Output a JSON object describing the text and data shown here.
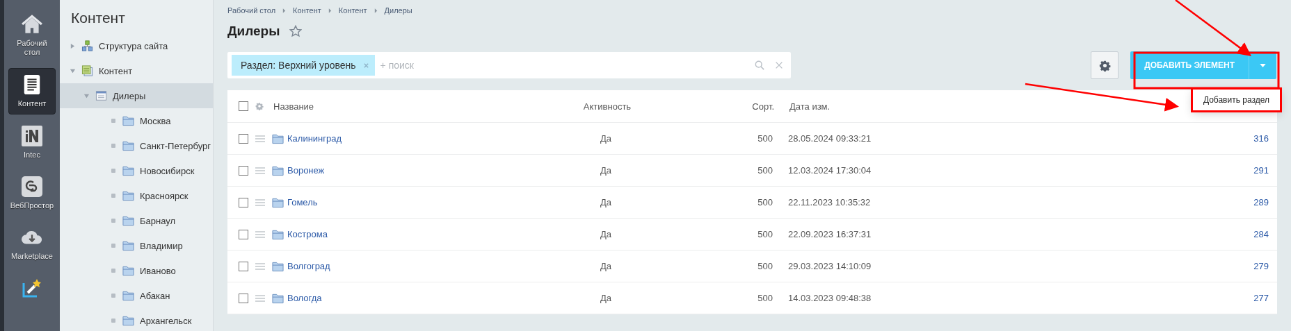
{
  "left_menu": [
    {
      "label": "Рабочий стол",
      "selected": false
    },
    {
      "label": "Контент",
      "selected": true
    },
    {
      "label": "Intec",
      "selected": false
    },
    {
      "label": "ВебПростор",
      "selected": false
    },
    {
      "label": "Marketplace",
      "selected": false
    },
    {
      "selected": false
    }
  ],
  "tree": {
    "title": "Контент",
    "items": [
      {
        "label": "Структура сайта",
        "kind": "structure",
        "expanded": false,
        "selected": false
      },
      {
        "label": "Контент",
        "kind": "content",
        "expanded": true,
        "selected": false,
        "children": [
          {
            "label": "Дилеры",
            "kind": "list",
            "expanded": true,
            "selected": true,
            "children": [
              {
                "label": "Москва",
                "kind": "folder",
                "selected": false
              },
              {
                "label": "Санкт-Петербург",
                "kind": "folder",
                "selected": false
              },
              {
                "label": "Новосибирск",
                "kind": "folder",
                "selected": false
              },
              {
                "label": "Красноярск",
                "kind": "folder",
                "selected": false
              },
              {
                "label": "Барнаул",
                "kind": "folder",
                "selected": false
              },
              {
                "label": "Владимир",
                "kind": "folder",
                "selected": false
              },
              {
                "label": "Иваново",
                "kind": "folder",
                "selected": false
              },
              {
                "label": "Абакан",
                "kind": "folder",
                "selected": false
              },
              {
                "label": "Архангельск",
                "kind": "folder",
                "selected": false
              }
            ]
          }
        ]
      }
    ]
  },
  "breadcrumbs": [
    "Рабочий стол",
    "Контент",
    "Контент",
    "Дилеры"
  ],
  "page_title": "Дилеры",
  "favorite": false,
  "filter": {
    "tag": "Раздел: Верхний уровень",
    "placeholder": "+ поиск"
  },
  "add_button": {
    "label": "ДОБАВИТЬ ЭЛЕМЕНТ",
    "menu": [
      "Добавить раздел"
    ]
  },
  "table": {
    "columns": [
      "Название",
      "Активность",
      "Сорт.",
      "Дата изм."
    ],
    "all_checked": false,
    "rows": [
      {
        "name": "Калининград",
        "active": "Да",
        "sort": "500",
        "date": "28.05.2024 09:33:21",
        "id": "316",
        "checked": false
      },
      {
        "name": "Воронеж",
        "active": "Да",
        "sort": "500",
        "date": "12.03.2024 17:30:04",
        "id": "291",
        "checked": false
      },
      {
        "name": "Гомель",
        "active": "Да",
        "sort": "500",
        "date": "22.11.2023 10:35:32",
        "id": "289",
        "checked": false
      },
      {
        "name": "Кострома",
        "active": "Да",
        "sort": "500",
        "date": "22.09.2023 16:37:31",
        "id": "284",
        "checked": false
      },
      {
        "name": "Волгоград",
        "active": "Да",
        "sort": "500",
        "date": "29.03.2023 14:10:09",
        "id": "279",
        "checked": false
      },
      {
        "name": "Вологда",
        "active": "Да",
        "sort": "500",
        "date": "14.03.2023 09:48:38",
        "id": "277",
        "checked": false
      }
    ]
  }
}
